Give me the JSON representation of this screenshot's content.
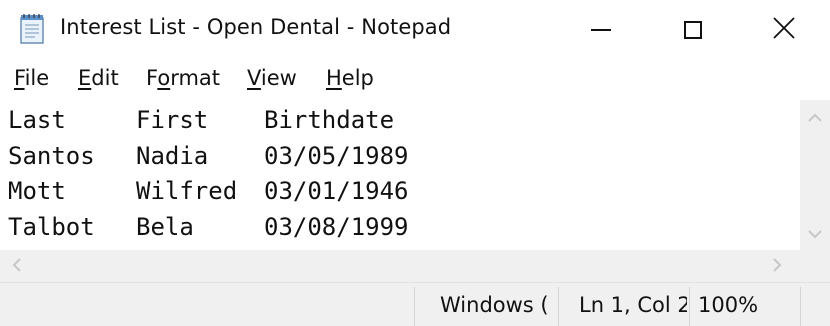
{
  "window": {
    "title": "Interest List - Open Dental - Notepad",
    "icon": "notepad-icon",
    "controls": {
      "minimize": "minimize-icon",
      "maximize": "maximize-icon",
      "close": "close-icon"
    }
  },
  "menu": {
    "items": [
      {
        "mnemonic": "F",
        "rest": "ile"
      },
      {
        "mnemonic": "E",
        "rest": "dit"
      },
      {
        "mnemonic": "o",
        "prefix": "F",
        "rest": "rmat"
      },
      {
        "mnemonic": "V",
        "rest": "iew"
      },
      {
        "mnemonic": "H",
        "rest": "elp"
      }
    ]
  },
  "document": {
    "columns": [
      "Last",
      "First",
      "Birthdate"
    ],
    "rows": [
      [
        "Santos",
        "Nadia",
        "03/05/1989"
      ],
      [
        "Mott",
        "Wilfred",
        "03/01/1946"
      ],
      [
        "Talbot",
        "Bela",
        "03/08/1999"
      ]
    ]
  },
  "statusbar": {
    "encoding": "Windows (",
    "position": "Ln 1, Col 2",
    "zoom": "100%"
  },
  "colors": {
    "background": "#ffffff",
    "chrome": "#f0f0f0",
    "text": "#111111",
    "scroll_arrow": "#c7c7c7"
  }
}
